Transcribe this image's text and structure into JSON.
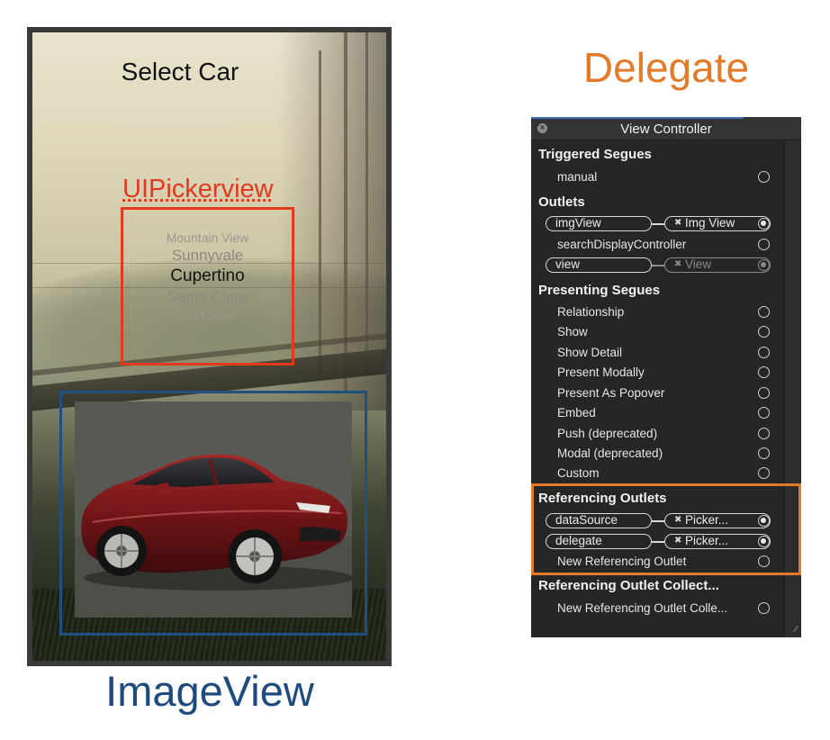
{
  "phone": {
    "title": "Select Car",
    "picker_label": "UIPickerview",
    "picker_rows": [
      "Mountain View",
      "Sunnyvale",
      "Cupertino",
      "Santa Clara",
      "San Jose"
    ],
    "imageview_label": "ImageView"
  },
  "delegate": {
    "title": "Delegate",
    "panel_title": "View Controller",
    "triggered_segues": {
      "header": "Triggered Segues",
      "items": [
        "manual"
      ]
    },
    "outlets": {
      "header": "Outlets",
      "img_view_name": "imgView",
      "img_view_target": "Img View",
      "search_display": "searchDisplayController",
      "view_name": "view",
      "view_target": "View"
    },
    "presenting_segues": {
      "header": "Presenting Segues",
      "items": [
        "Relationship",
        "Show",
        "Show Detail",
        "Present Modally",
        "Present As Popover",
        "Embed",
        "Push (deprecated)",
        "Modal (deprecated)",
        "Custom"
      ]
    },
    "referencing_outlets": {
      "header": "Referencing Outlets",
      "data_source": "dataSource",
      "data_source_target": "Picker...",
      "delegate": "delegate",
      "delegate_target": "Picker...",
      "new_outlet": "New Referencing Outlet"
    },
    "outlet_collections": {
      "header": "Referencing Outlet Collect...",
      "new_collection": "New Referencing Outlet Colle..."
    }
  },
  "colors": {
    "picker_highlight": "#e03a1f",
    "imageview_highlight": "#1f4a7e",
    "delegate_highlight": "#e37b2a"
  }
}
